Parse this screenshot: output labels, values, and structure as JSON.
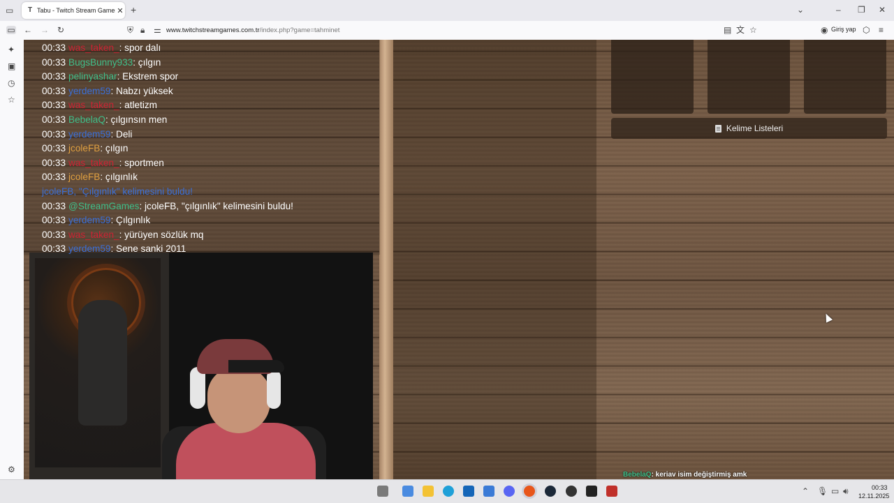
{
  "browser": {
    "tab_title": "Tabu - Twitch Stream Games",
    "tab_favicon": "T",
    "url_domain": "www.twitchstreamgames.com.tr",
    "url_path": "/index.php?game=tahminet",
    "signin_label": "Giriş yap"
  },
  "game": {
    "word_list_button": "Kelime Listeleri"
  },
  "chat": {
    "messages": [
      {
        "time": "00:33",
        "user": "was_taken_",
        "user_color": "#cc2233",
        "text": ": spor dalı"
      },
      {
        "time": "00:33",
        "user": "BugsBunny933",
        "user_color": "#3fbf8a",
        "text": ": çılgın"
      },
      {
        "time": "00:33",
        "user": "pelinyashar",
        "user_color": "#3fbf8a",
        "text": ": Ekstrem spor"
      },
      {
        "time": "00:33",
        "user": "yerdem59",
        "user_color": "#3a6fd8",
        "text": ": Nabzı yüksek"
      },
      {
        "time": "00:33",
        "user": "was_taken_",
        "user_color": "#cc2233",
        "text": ": atletizm"
      },
      {
        "time": "00:33",
        "user": "BebelaQ",
        "user_color": "#3fbf8a",
        "text": ": çılgınsın men"
      },
      {
        "time": "00:33",
        "user": "yerdem59",
        "user_color": "#3a6fd8",
        "text": ": Deli"
      },
      {
        "time": "00:33",
        "user": "jcoleFB",
        "user_color": "#e0a040",
        "text": ": çılgın"
      },
      {
        "time": "00:33",
        "user": "was_taken_",
        "user_color": "#cc2233",
        "text": ": sportmen"
      },
      {
        "time": "00:33",
        "user": "jcoleFB",
        "user_color": "#e0a040",
        "text": ": çılgınlık"
      },
      {
        "time": "",
        "user": "",
        "user_color": "#3a6fd8",
        "text": "jcoleFB, \"Çılgınlık\" kelimesini buldu!"
      },
      {
        "time": "00:33",
        "user": "@StreamGames",
        "user_color": "#3fbf8a",
        "text": ": jcoleFB, \"çılgınlık\" kelimesini buldu!"
      },
      {
        "time": "00:33",
        "user": "yerdem59",
        "user_color": "#3a6fd8",
        "text": ": Çılgınlık"
      },
      {
        "time": "00:33",
        "user": "was_taken_",
        "user_color": "#cc2233",
        "text": ": yürüyen sözlük mq"
      },
      {
        "time": "00:33",
        "user": "yerdem59",
        "user_color": "#3a6fd8",
        "text": ": Sene sanki 2011"
      }
    ]
  },
  "overlay_chat": {
    "user": "BebelaQ",
    "text": ": keriav isim değiştirmiş amk"
  },
  "taskbar": {
    "time": "00:33",
    "date": "12.11.2025"
  }
}
